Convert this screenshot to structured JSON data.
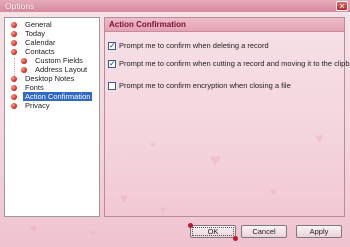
{
  "window": {
    "title": "Options",
    "close_glyph": "✕"
  },
  "tree": {
    "items": [
      {
        "label": "General",
        "level": 0,
        "selected": false
      },
      {
        "label": "Today",
        "level": 0,
        "selected": false
      },
      {
        "label": "Calendar",
        "level": 0,
        "selected": false
      },
      {
        "label": "Contacts",
        "level": 0,
        "selected": false
      },
      {
        "label": "Custom Fields",
        "level": 1,
        "selected": false
      },
      {
        "label": "Address Layout",
        "level": 1,
        "selected": false
      },
      {
        "label": "Desktop Notes",
        "level": 0,
        "selected": false
      },
      {
        "label": "Fonts",
        "level": 0,
        "selected": false
      },
      {
        "label": "Action Confirmation",
        "level": 0,
        "selected": true
      },
      {
        "label": "Privacy",
        "level": 0,
        "selected": false
      }
    ]
  },
  "panel": {
    "title": "Action Confirmation",
    "options": [
      {
        "label": "Prompt me to confirm when deleting a record",
        "checked": true
      },
      {
        "label": "Prompt me to confirm when cutting a record and moving it to the clipboard",
        "checked": true
      },
      {
        "label": "Prompt me to confirm encryption when closing a file",
        "checked": false
      }
    ],
    "check_glyph": "✓"
  },
  "buttons": {
    "ok": "OK",
    "cancel": "Cancel",
    "apply": "Apply"
  },
  "colors": {
    "accent": "#316ac5",
    "header_text": "#7a1030",
    "bullet": "#d0201a",
    "background": "#f6dce3"
  }
}
